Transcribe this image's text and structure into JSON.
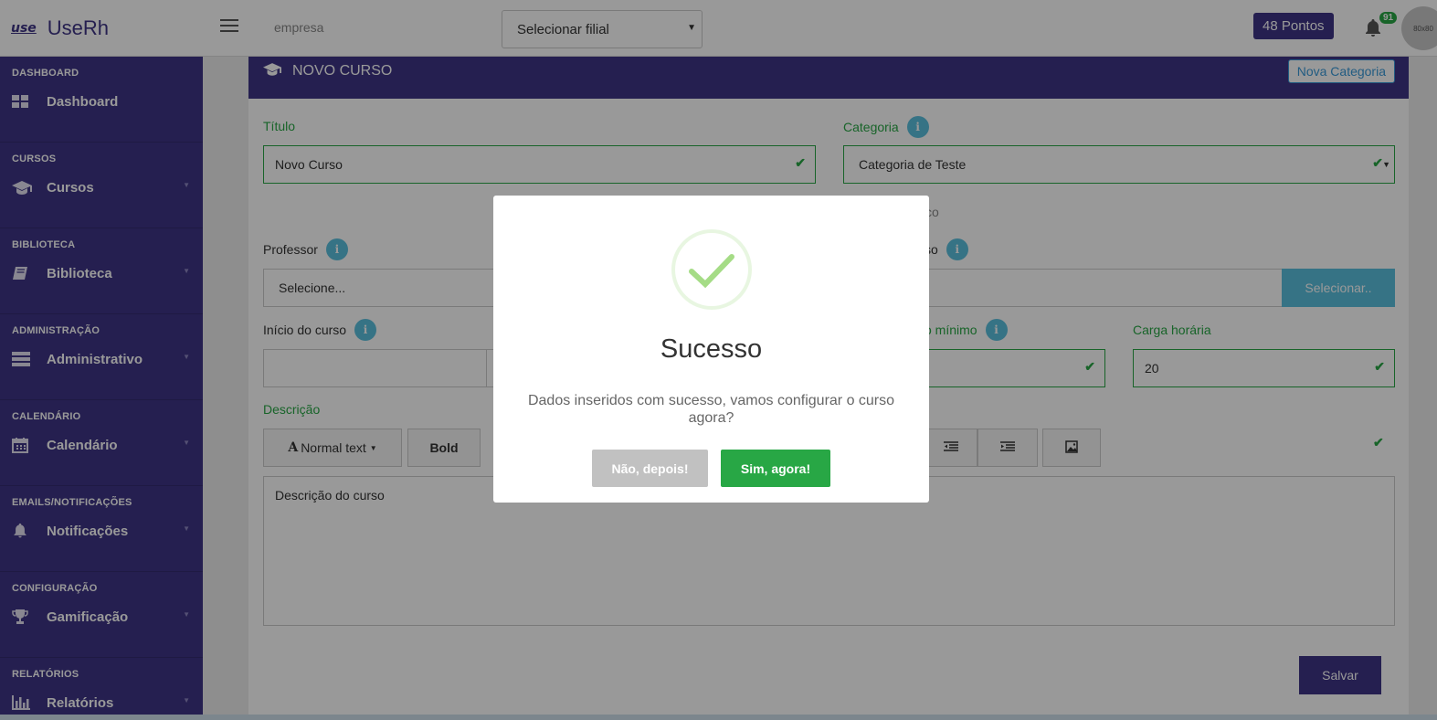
{
  "app": {
    "logo_mark": "use",
    "name": "UseRh"
  },
  "topbar": {
    "empresa": "empresa",
    "filial_select": "Selecionar filial",
    "pontos": "48 Pontos",
    "notifications_count": "91",
    "avatar_text": "80x80"
  },
  "sidebar": {
    "sections": [
      {
        "header": "DASHBOARD",
        "item": "Dashboard",
        "icon": "dashboard-icon"
      },
      {
        "header": "CURSOS",
        "item": "Cursos",
        "icon": "graduation-cap-icon"
      },
      {
        "header": "BIBLIOTECA",
        "item": "Biblioteca",
        "icon": "book-icon"
      },
      {
        "header": "ADMINISTRAÇÃO",
        "item": "Administrativo",
        "icon": "server-icon"
      },
      {
        "header": "CALENDÁRIO",
        "item": "Calendário",
        "icon": "calendar-icon"
      },
      {
        "header": "EMAILS/NOTIFICAÇÕES",
        "item": "Notificações",
        "icon": "bell-icon"
      },
      {
        "header": "CONFIGURAÇÃO",
        "item": "Gamificação",
        "icon": "trophy-icon"
      },
      {
        "header": "RELATÓRIOS",
        "item": "Relatórios",
        "icon": "bar-chart-icon"
      }
    ]
  },
  "form": {
    "panel_title": "NOVO CURSO",
    "nova_categoria": "Nova Categoria",
    "titulo_label": "Título",
    "titulo_value": "Novo Curso",
    "categoria_label": "Categoria",
    "categoria_value": "Categoria de Teste",
    "partial_label_co": "co",
    "professor_label": "Professor",
    "professor_value": "Selecione...",
    "partial_label_so": "so",
    "selecionar_button": "Selecionar..",
    "inicio_label": "Início do curso",
    "partial_label_minimo": "o mínimo",
    "carga_label": "Carga horária",
    "carga_value": "20",
    "descricao_label": "Descrição",
    "toolbar_normal_text": "Normal text",
    "toolbar_bold": "Bold",
    "editor_text": "Descrição do curso",
    "salvar": "Salvar"
  },
  "modal": {
    "title": "Sucesso",
    "text": "Dados inseridos com sucesso, vamos configurar o curso agora?",
    "cancel": "Não, depois!",
    "confirm": "Sim, agora!"
  }
}
